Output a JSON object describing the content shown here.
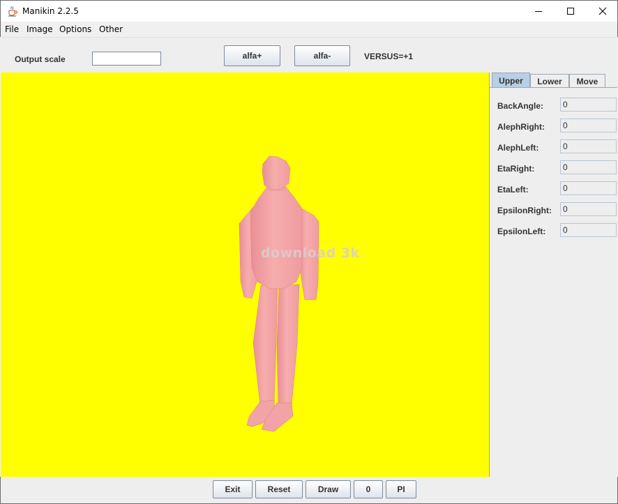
{
  "window": {
    "title": "Manikin 2.2.5",
    "app_icon": "java-cup-icon"
  },
  "menu": [
    "File",
    "Image",
    "Options",
    "Other"
  ],
  "toolbar": {
    "scale_label": "Output scale",
    "scale_value": "",
    "alfa_plus": "alfa+",
    "alfa_minus": "alfa-",
    "versus": "VERSUS=+1"
  },
  "canvas": {
    "background": "#ffff00",
    "figure_color": "#f4a5a5",
    "watermark": "download 3k"
  },
  "tabs": [
    "Upper",
    "Lower",
    "Move"
  ],
  "active_tab": "Upper",
  "fields": [
    {
      "label": "BackAngle:",
      "value": "0"
    },
    {
      "label": "AlephRight:",
      "value": "0"
    },
    {
      "label": "AlephLeft:",
      "value": "0"
    },
    {
      "label": "EtaRight:",
      "value": "0"
    },
    {
      "label": "EtaLeft:",
      "value": "0"
    },
    {
      "label": "EpsilonRight:",
      "value": "0"
    },
    {
      "label": "EpsilonLeft:",
      "value": "0"
    }
  ],
  "buttons": [
    "Exit",
    "Reset",
    "Draw",
    "0",
    "PI"
  ]
}
